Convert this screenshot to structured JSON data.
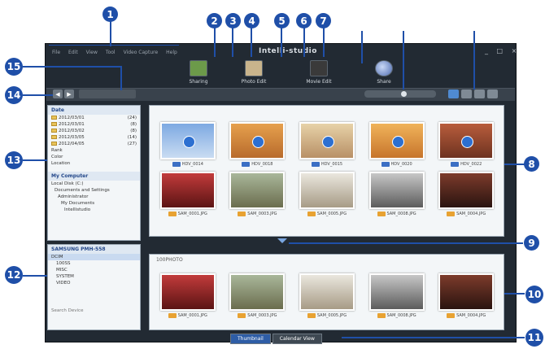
{
  "app": {
    "title": "Intelli-studio",
    "window_controls": "_ □ ×"
  },
  "menu": [
    "File",
    "Edit",
    "View",
    "Tool",
    "Video Capture",
    "Help"
  ],
  "toolbar": {
    "tools": [
      {
        "label": "Sharing",
        "icon": "sharing-icon"
      },
      {
        "label": "Photo Edit",
        "icon": "photo-edit-icon"
      },
      {
        "label": "Movie Edit",
        "icon": "movie-edit-icon"
      },
      {
        "label": "Share",
        "icon": "share-globe-icon"
      }
    ]
  },
  "nav": {
    "back": "◀",
    "forward": "▶"
  },
  "zoom": {
    "level": 0.55
  },
  "view_buttons": [
    "view-thumbnail",
    "view-single",
    "view-split",
    "view-list"
  ],
  "tree": {
    "header": "Date",
    "dates": [
      {
        "label": "2012/03/01",
        "count": "(24)"
      },
      {
        "label": "2012/03/01",
        "count": "(8)"
      },
      {
        "label": "2012/03/02",
        "count": "(8)"
      },
      {
        "label": "2012/03/05",
        "count": "(14)"
      },
      {
        "label": "2012/04/05",
        "count": "(27)"
      }
    ],
    "other": [
      "Rank",
      "Color",
      "Location"
    ],
    "computer_header": "My Computer",
    "computer_items": [
      "Local Disk (C:)",
      "Documents and Settings",
      "Administrator",
      "My Documents",
      "Intellistudio"
    ],
    "device_header": "SAMSUNG PMH-558",
    "device_items": [
      "DCIM",
      "100SS",
      "MISC",
      "SYSTEM",
      "VIDEO"
    ],
    "footer_btn": "Search Device"
  },
  "thumbnails": [
    {
      "name": "HDV_0014",
      "type": "mov"
    },
    {
      "name": "HDV_0018",
      "type": "mov"
    },
    {
      "name": "HDV_0015",
      "type": "mov"
    },
    {
      "name": "HDV_0020",
      "type": "mov"
    },
    {
      "name": "HDV_0022",
      "type": "mov"
    },
    {
      "name": "SAM_0001.JPG",
      "type": "img"
    },
    {
      "name": "SAM_0003.JPG",
      "type": "img"
    },
    {
      "name": "SAM_0005.JPG",
      "type": "img"
    },
    {
      "name": "SAM_0008.JPG",
      "type": "img"
    },
    {
      "name": "SAM_0004.JPG",
      "type": "img"
    }
  ],
  "lower": {
    "folder": "100PHOTO",
    "thumbnails": [
      {
        "name": "SAM_0001.JPG"
      },
      {
        "name": "SAM_0003.JPG"
      },
      {
        "name": "SAM_0005.JPG"
      },
      {
        "name": "SAM_0008.JPG"
      },
      {
        "name": "SAM_0004.JPG"
      }
    ]
  },
  "tabs": [
    "Thumbnail",
    "Calendar View"
  ],
  "callouts": [
    "1",
    "2",
    "3",
    "4",
    "5",
    "6",
    "7",
    "8",
    "9",
    "10",
    "11",
    "12",
    "13",
    "14",
    "15"
  ],
  "colors": {
    "callout": "#1f4fa8",
    "window": "#222a33",
    "panel": "#f3f6f8"
  }
}
